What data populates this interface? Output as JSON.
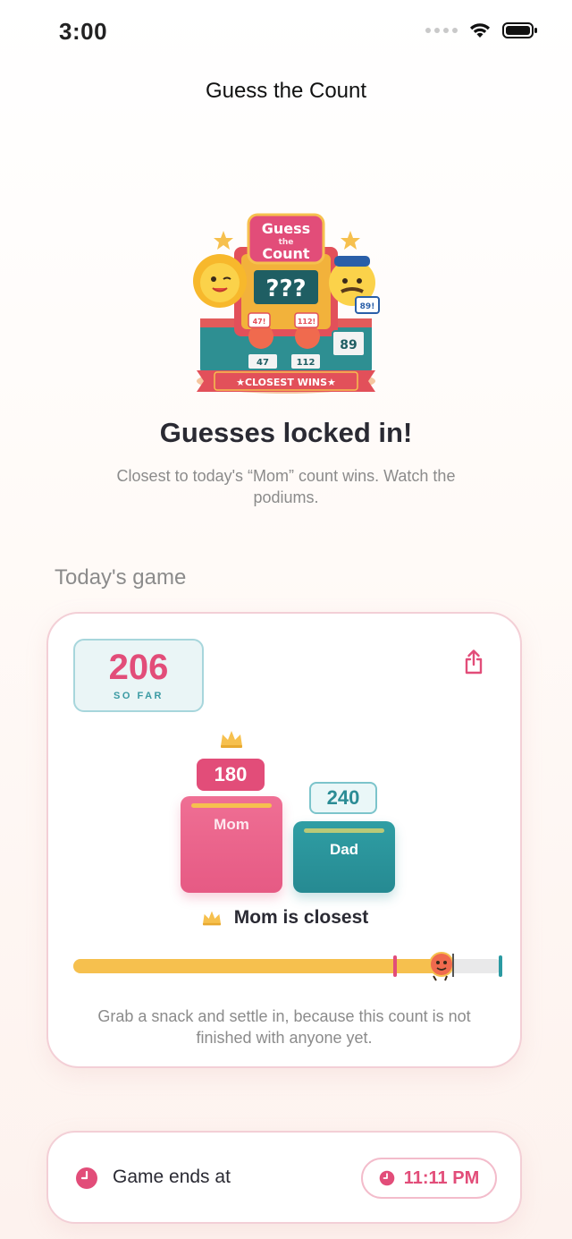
{
  "status_bar": {
    "time": "3:00"
  },
  "nav": {
    "title": "Guess the Count"
  },
  "hero": {
    "illustration_text": {
      "sign_top": "Guess",
      "sign_mid": "the",
      "sign_bottom": "Count",
      "board": "???",
      "banner": "★CLOSEST WINS★",
      "card_left": "47!",
      "card_right": "112!",
      "board_left": "47",
      "board_right": "112",
      "mascot_card": "89!",
      "stand_right": "89"
    },
    "title": "Guesses locked in!",
    "subtitle": "Closest to today's “Mom” count wins. Watch the podiums."
  },
  "section_label": "Today's game",
  "game": {
    "count": "206",
    "count_caption": "SO FAR",
    "share_icon": "share-icon",
    "players": [
      {
        "name": "Mom",
        "guess": "180",
        "color": "#e24d79",
        "leader": true
      },
      {
        "name": "Dad",
        "guess": "240",
        "color": "#2b9aa2",
        "leader": false
      }
    ],
    "closest_text": "Mom is closest",
    "progress": {
      "fill_fraction": 0.86,
      "mom_marker_fraction": 0.75,
      "dad_marker_fraction": 1.0,
      "mascot_fraction": 0.86
    },
    "footer": "Grab a snack and settle in, because this count is not finished with anyone yet."
  },
  "ends": {
    "label": "Game ends at",
    "time": "11:11 PM",
    "icon": "clock-icon",
    "accent": "#e24d79"
  }
}
